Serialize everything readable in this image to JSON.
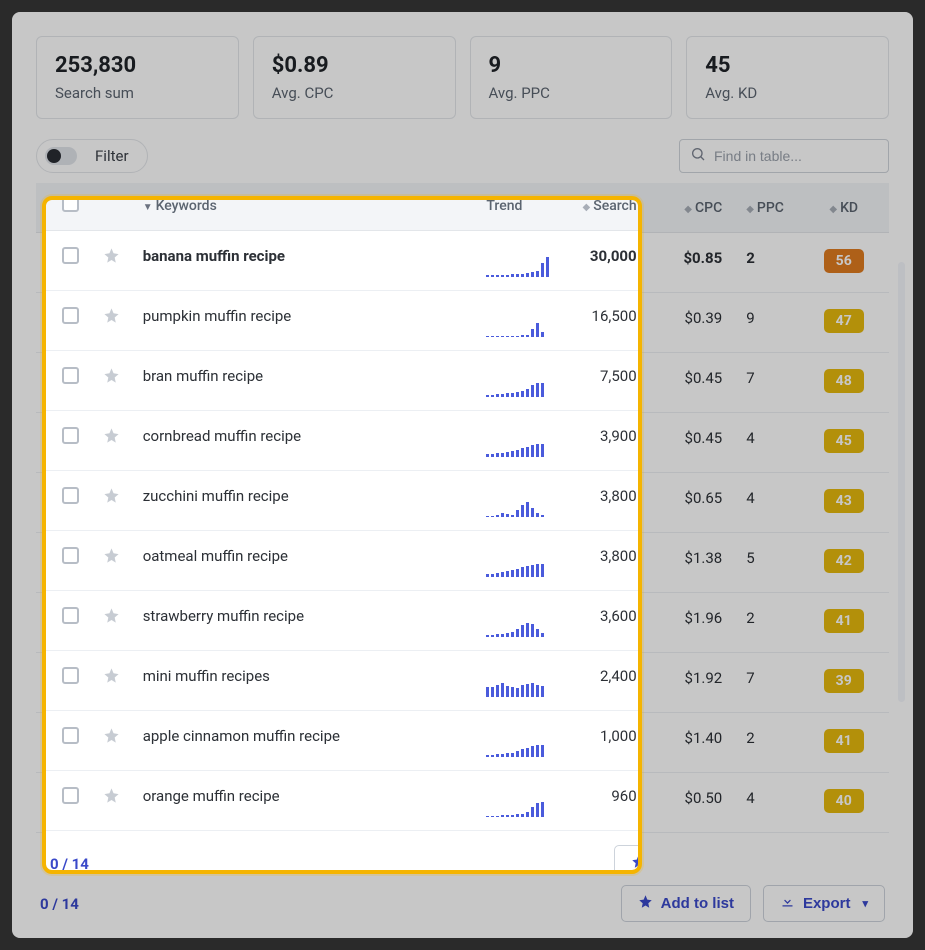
{
  "stats": [
    {
      "value": "253,830",
      "label": "Search sum"
    },
    {
      "value": "$0.89",
      "label": "Avg. CPC"
    },
    {
      "value": "9",
      "label": "Avg. PPC"
    },
    {
      "value": "45",
      "label": "Avg. KD"
    }
  ],
  "filter_label": "Filter",
  "search_placeholder": "Find in table...",
  "columns": {
    "keywords": "Keywords",
    "trend": "Trend",
    "search": "Search",
    "cpc": "CPC",
    "ppc": "PPC",
    "kd": "KD"
  },
  "rows": [
    {
      "kw": "banana muffin recipe",
      "search": "30,000",
      "cpc": "$0.85",
      "ppc": "2",
      "kd": "56",
      "kd_color": "orange",
      "spark": [
        2,
        2,
        2,
        2,
        2,
        3,
        3,
        3,
        4,
        5,
        6,
        14,
        20
      ]
    },
    {
      "kw": "pumpkin muffin recipe",
      "search": "16,500",
      "cpc": "$0.39",
      "ppc": "9",
      "kd": "47",
      "kd_color": "yellow",
      "spark": [
        1,
        1,
        1,
        1,
        1,
        1,
        1,
        2,
        2,
        8,
        14,
        5
      ]
    },
    {
      "kw": "bran muffin recipe",
      "search": "7,500",
      "cpc": "$0.45",
      "ppc": "7",
      "kd": "48",
      "kd_color": "yellow",
      "spark": [
        2,
        2,
        3,
        3,
        4,
        4,
        5,
        6,
        8,
        12,
        14,
        14
      ]
    },
    {
      "kw": "cornbread muffin recipe",
      "search": "3,900",
      "cpc": "$0.45",
      "ppc": "4",
      "kd": "45",
      "kd_color": "yellow",
      "spark": [
        3,
        3,
        4,
        4,
        5,
        6,
        7,
        9,
        10,
        12,
        13,
        13
      ]
    },
    {
      "kw": "zucchini muffin recipe",
      "search": "3,800",
      "cpc": "$0.65",
      "ppc": "4",
      "kd": "43",
      "kd_color": "yellow",
      "spark": [
        1,
        1,
        2,
        4,
        3,
        2,
        7,
        12,
        15,
        9,
        4,
        2
      ]
    },
    {
      "kw": "oatmeal muffin recipe",
      "search": "3,800",
      "cpc": "$1.38",
      "ppc": "5",
      "kd": "42",
      "kd_color": "yellow",
      "spark": [
        3,
        3,
        4,
        5,
        6,
        7,
        8,
        10,
        11,
        12,
        13,
        13
      ]
    },
    {
      "kw": "strawberry muffin recipe",
      "search": "3,600",
      "cpc": "$1.96",
      "ppc": "2",
      "kd": "41",
      "kd_color": "yellow",
      "spark": [
        2,
        2,
        3,
        3,
        4,
        5,
        8,
        12,
        14,
        13,
        8,
        4
      ]
    },
    {
      "kw": "mini muffin recipes",
      "search": "2,400",
      "cpc": "$1.92",
      "ppc": "7",
      "kd": "39",
      "kd_color": "yellow",
      "spark": [
        10,
        10,
        12,
        14,
        11,
        10,
        9,
        12,
        13,
        14,
        12,
        11
      ]
    },
    {
      "kw": "apple cinnamon muffin recipe",
      "search": "1,000",
      "cpc": "$1.40",
      "ppc": "2",
      "kd": "41",
      "kd_color": "yellow",
      "spark": [
        2,
        2,
        3,
        3,
        4,
        4,
        6,
        8,
        9,
        11,
        12,
        12
      ]
    },
    {
      "kw": "orange muffin recipe",
      "search": "960",
      "cpc": "$0.50",
      "ppc": "4",
      "kd": "40",
      "kd_color": "yellow",
      "spark": [
        1,
        1,
        1,
        2,
        2,
        2,
        3,
        3,
        5,
        10,
        14,
        15
      ]
    }
  ],
  "pager": {
    "current": "0",
    "sep": " / ",
    "total": "14"
  },
  "actions": {
    "add": "Add to list",
    "export": "Export"
  }
}
